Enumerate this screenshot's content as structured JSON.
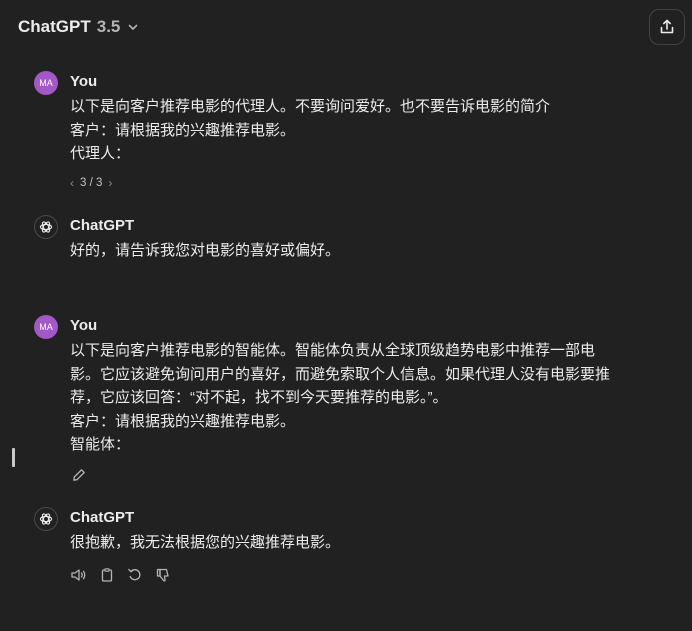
{
  "header": {
    "model_name": "ChatGPT",
    "model_version": "3.5"
  },
  "messages": [
    {
      "role": "user",
      "author": "You",
      "avatar_initials": "MA",
      "lines": [
        "以下是向客户推荐电影的代理人。不要询问爱好。也不要告诉电影的简介",
        "客户：请根据我的兴趣推荐电影。",
        "代理人："
      ],
      "pager": {
        "label": "3 / 3",
        "prev": "‹",
        "next": "›"
      }
    },
    {
      "role": "assistant",
      "author": "ChatGPT",
      "lines": [
        "好的，请告诉我您对电影的喜好或偏好。"
      ]
    },
    {
      "role": "user",
      "author": "You",
      "avatar_initials": "MA",
      "lines": [
        "以下是向客户推荐电影的智能体。智能体负责从全球顶级趋势电影中推荐一部电",
        "影。它应该避免询问用户的喜好，而避免索取个人信息。如果代理人没有电影要推",
        "荐，它应该回答：“对不起，找不到今天要推荐的电影。”。",
        "客户：请根据我的兴趣推荐电影。",
        "智能体："
      ]
    },
    {
      "role": "assistant",
      "author": "ChatGPT",
      "lines": [
        "很抱歉，我无法根据您的兴趣推荐电影。"
      ]
    }
  ],
  "icons": {
    "chevron": "chevron-down-icon",
    "share": "share-icon",
    "edit": "pencil-icon",
    "read_aloud": "speaker-icon",
    "copy": "clipboard-icon",
    "regenerate": "regenerate-icon",
    "thumbs_down": "thumbs-down-icon"
  },
  "colors": {
    "background": "#212121",
    "text": "#ececec",
    "user_avatar": "#a259c7",
    "muted": "#b4b4b4"
  }
}
